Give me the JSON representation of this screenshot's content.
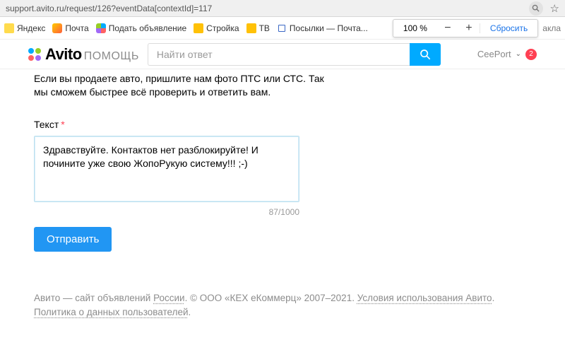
{
  "browser": {
    "url": "support.avito.ru/request/126?eventData[contextId]=117",
    "star_icon": "☆"
  },
  "bookmarks": {
    "items": [
      {
        "label": "Яндекс",
        "fav": "yx"
      },
      {
        "label": "Почта",
        "fav": "mail"
      },
      {
        "label": "Подать объявление",
        "fav": "dots"
      },
      {
        "label": "Стройка",
        "fav": "str"
      },
      {
        "label": "ТВ",
        "fav": "tv"
      },
      {
        "label": "Посылки — Почта...",
        "fav": "post"
      }
    ],
    "cutoff": "акла"
  },
  "zoom": {
    "percent": "100 %",
    "minus": "−",
    "plus": "+",
    "reset": "Сбросить"
  },
  "header": {
    "brand_main": "Avito",
    "brand_section": "помощь",
    "search_placeholder": "Найти ответ",
    "user_name": "CeePort",
    "badge": "2"
  },
  "main": {
    "intro_line1": "Если вы продаете авто, пришлите нам фото ПТС или СТС. Так",
    "intro_line2": "мы сможем быстрее всё проверить и ответить вам.",
    "text_label": "Текст",
    "textarea_value": "Здравствуйте. Контактов нет разблокируйте! И почините уже свою ЖопоРукую систему!!! ;-)",
    "counter": "87/1000",
    "submit_label": "Отправить"
  },
  "footer": {
    "pre": "Авито — сайт объявлений ",
    "russia": "России",
    "mid": ". © ООО «КЕХ еКоммерц» 2007–2021. ",
    "terms": "Условия использования Авито",
    "sep": ". ",
    "privacy": "Политика о данных пользователей",
    "end": "."
  }
}
